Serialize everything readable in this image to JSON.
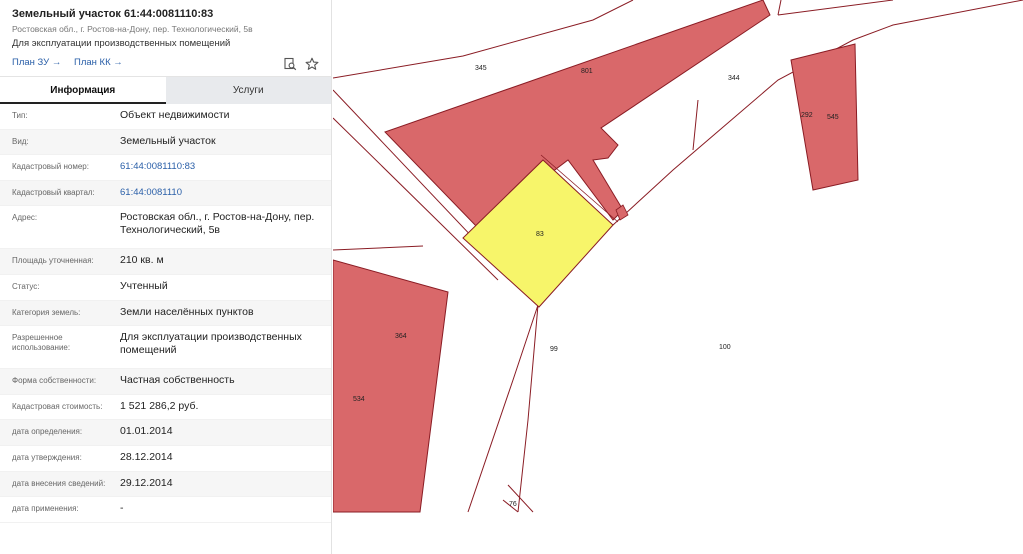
{
  "header": {
    "title": "Земельный участок 61:44:0081110:83",
    "address": "Ростовская обл., г. Ростов-на-Дону, пер. Технологический, 5в",
    "purpose": "Для эксплуатации производственных помещений",
    "link_plan_zu": "План ЗУ →",
    "link_plan_kk": "План КК →",
    "icons": [
      "search-map-icon",
      "star-icon"
    ]
  },
  "tabs": [
    {
      "label": "Информация",
      "active": true
    },
    {
      "label": "Услуги",
      "active": false
    }
  ],
  "info": [
    {
      "label": "Тип:",
      "value": "Объект недвижимости"
    },
    {
      "label": "Вид:",
      "value": "Земельный участок"
    },
    {
      "label": "Кадастровый номер:",
      "value": "61:44:0081110:83"
    },
    {
      "label": "Кадастровый квартал:",
      "value": "61:44:0081110"
    },
    {
      "label": "Адрес:",
      "value": "Ростовская обл., г. Ростов-на-Дону, пер. Технологический, 5в"
    },
    {
      "label": "Площадь уточненная:",
      "value": "210 кв. м"
    },
    {
      "label": "Статус:",
      "value": "Учтенный"
    },
    {
      "label": "Категория земель:",
      "value": "Земли населённых пунктов"
    },
    {
      "label": "Разрешенное использование:",
      "value": "Для эксплуатации производственных помещений"
    },
    {
      "label": "Форма собственности:",
      "value": "Частная собственность"
    },
    {
      "label": "Кадастровая стоимость:",
      "value": "1 521 286,2 руб."
    },
    {
      "label": "дата определения:",
      "value": "01.01.2014"
    },
    {
      "label": "дата утверждения:",
      "value": "28.12.2014"
    },
    {
      "label": "дата внесения сведений:",
      "value": "29.12.2014"
    },
    {
      "label": "дата применения:",
      "value": "-"
    }
  ],
  "map": {
    "colors": {
      "parcel_fill": "#d9686a",
      "parcel_stroke": "#8a1c24",
      "selected_fill": "#f7f56a",
      "boundary": "#8a1c24"
    },
    "labels": {
      "p345": "345",
      "p801": "801",
      "p344": "344",
      "p292": "292",
      "p545": "545",
      "p83": "83",
      "p364": "364",
      "p534": "534",
      "p99": "99",
      "p100": "100",
      "p76": "76"
    }
  }
}
